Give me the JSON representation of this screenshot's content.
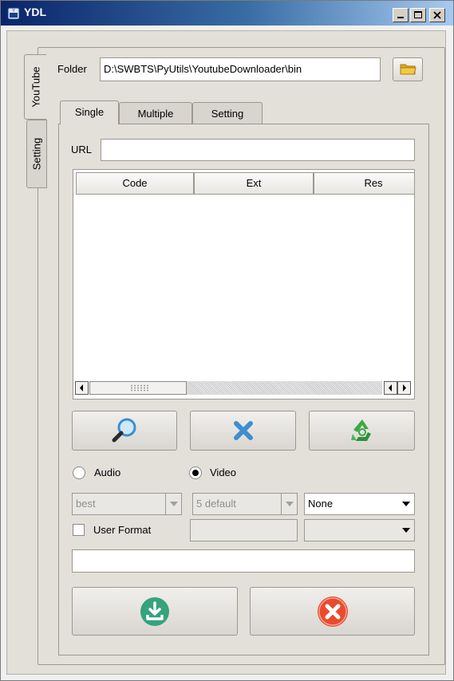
{
  "window": {
    "title": "YDL"
  },
  "side_tabs": [
    {
      "label": "YouTube"
    },
    {
      "label": "Setting"
    }
  ],
  "folder": {
    "label": "Folder",
    "value": "D:\\SWBTS\\PyUtils\\YoutubeDownloader\\bin"
  },
  "tabs": [
    {
      "label": "Single"
    },
    {
      "label": "Multiple"
    },
    {
      "label": "Setting"
    }
  ],
  "url": {
    "label": "URL",
    "value": ""
  },
  "table": {
    "columns": [
      "Code",
      "Ext",
      "Res"
    ],
    "rows": []
  },
  "radios": {
    "audio_label": "Audio",
    "video_label": "Video",
    "selected": "Video"
  },
  "combos": {
    "quality": "best",
    "preset": "5 default",
    "option": "None",
    "extra": ""
  },
  "user_format": {
    "label": "User Format",
    "checked": false,
    "value": ""
  },
  "output_field": {
    "value": ""
  },
  "colors": {
    "search_lens": "#3a8fd4",
    "cancel_x": "#3d8fcf",
    "recycle": "#3aa845",
    "download": "#34a37e",
    "stop": "#ea4b2e"
  }
}
